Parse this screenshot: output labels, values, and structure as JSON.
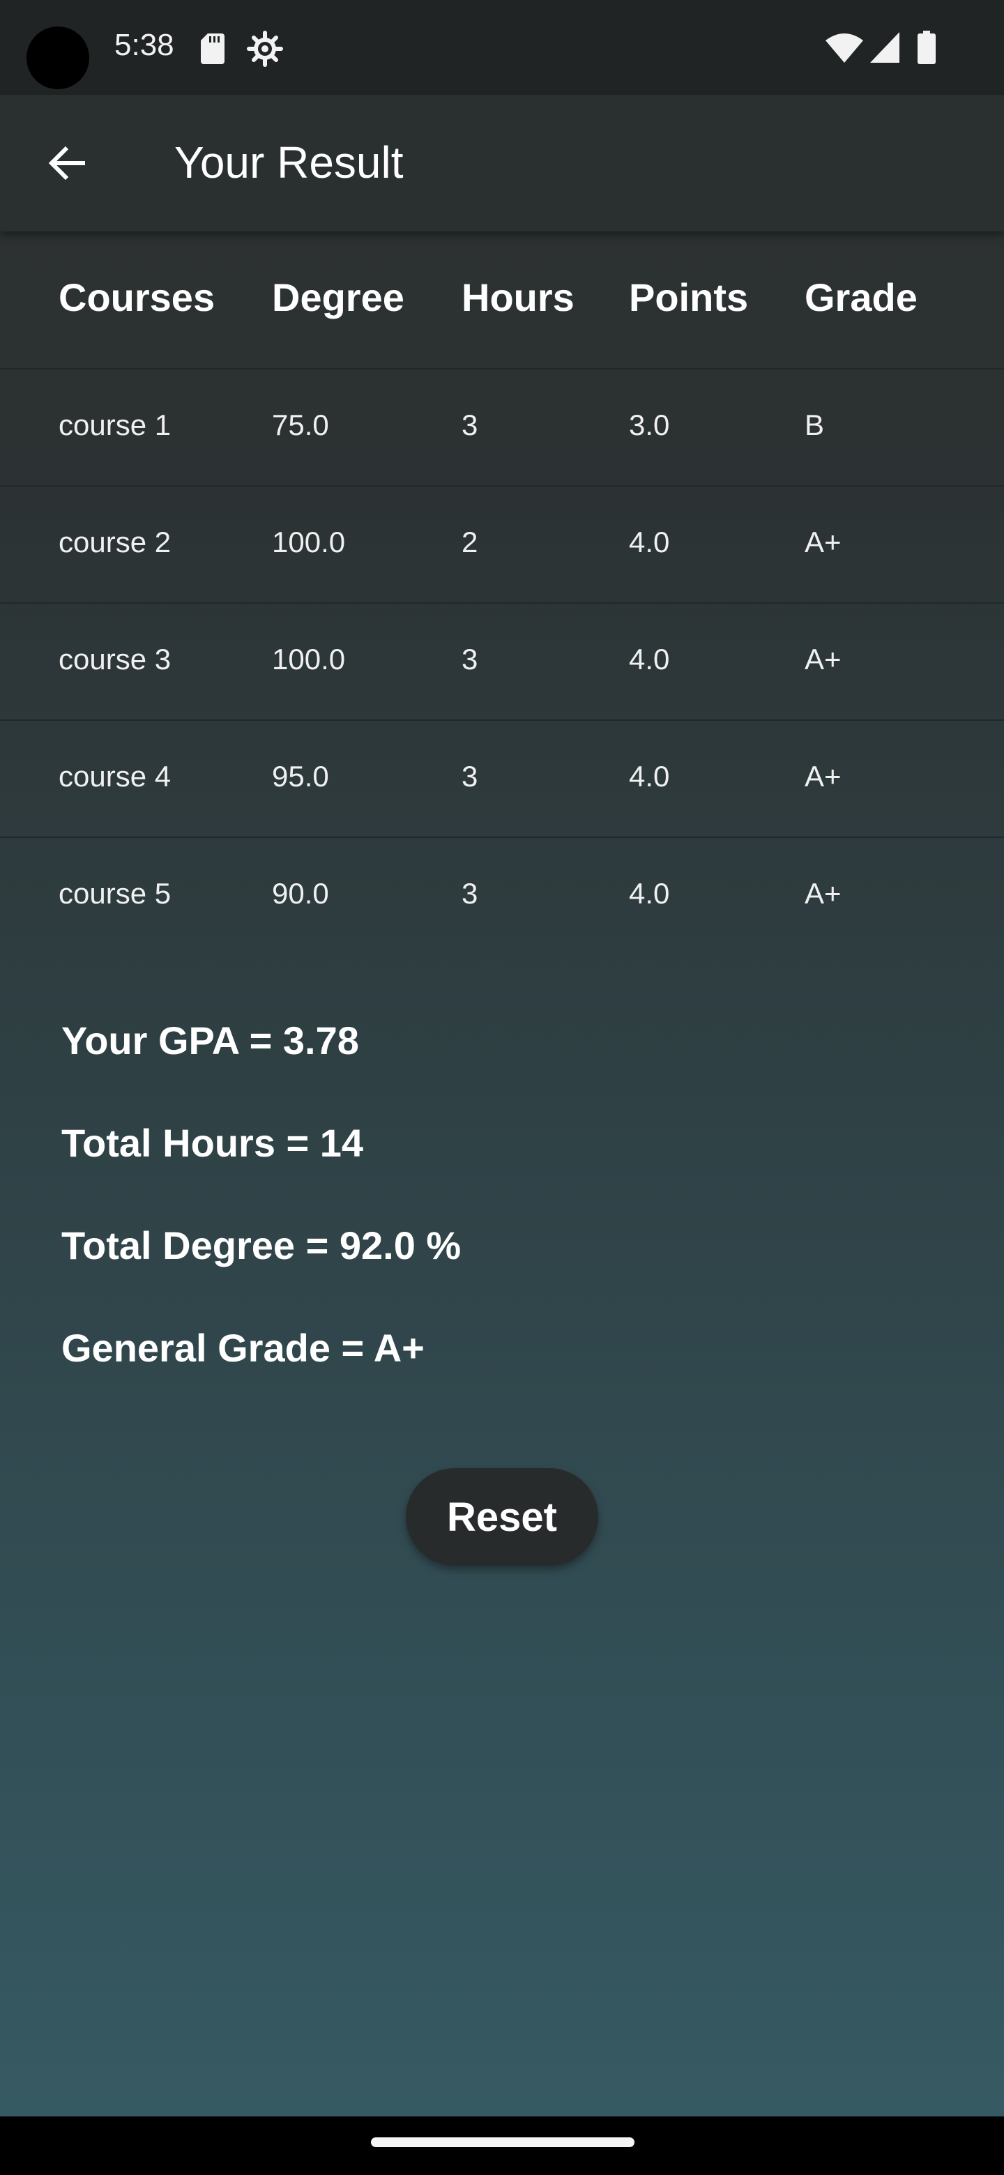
{
  "status_bar": {
    "time": "5:38",
    "icons": [
      "sd-card-icon",
      "settings-gear-icon",
      "wifi-icon",
      "cell-signal-icon",
      "battery-icon"
    ]
  },
  "app_bar": {
    "title": "Your Result",
    "back_icon": "arrow-back-icon"
  },
  "table": {
    "headers": [
      "Courses",
      "Degree",
      "Hours",
      "Points",
      "Grade"
    ],
    "rows": [
      [
        "course 1",
        "75.0",
        "3",
        "3.0",
        "B"
      ],
      [
        "course 2",
        "100.0",
        "2",
        "4.0",
        "A+"
      ],
      [
        "course 3",
        "100.0",
        "3",
        "4.0",
        "A+"
      ],
      [
        "course 4",
        "95.0",
        "3",
        "4.0",
        "A+"
      ],
      [
        "course 5",
        "90.0",
        "3",
        "4.0",
        "A+"
      ]
    ]
  },
  "summary": {
    "gpa": "Your GPA = 3.78",
    "total_hours": "Total Hours = 14",
    "total_degree": "Total Degree = 92.0 %",
    "general_grade": "General Grade = A+"
  },
  "reset_button": {
    "label": "Reset"
  },
  "colors": {
    "app_bar": "#2a2f30",
    "background_top": "#2b2f2f",
    "background_bottom": "#365a63",
    "button": "#272b2c",
    "text": "#ffffff"
  }
}
